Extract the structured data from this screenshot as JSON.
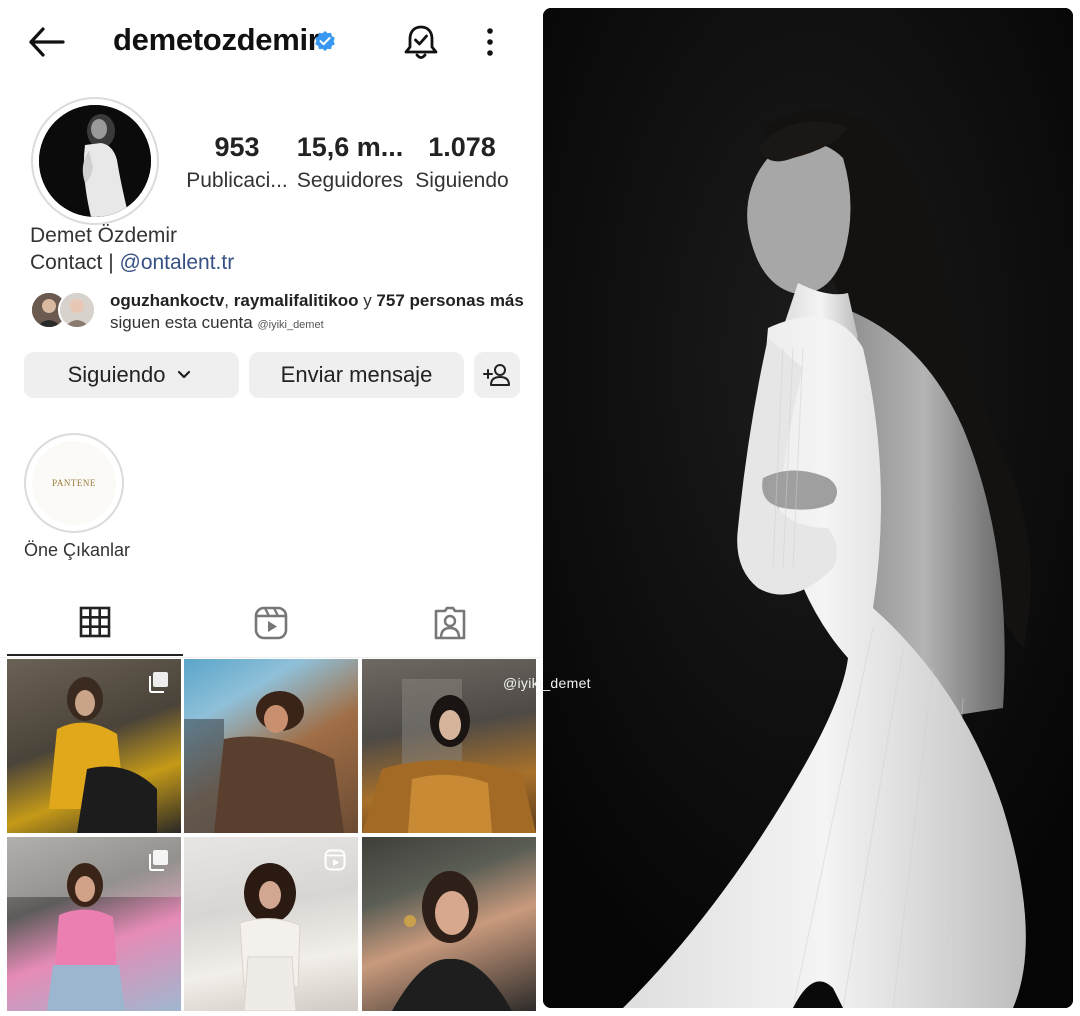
{
  "header": {
    "username": "demetozdemir"
  },
  "stats": {
    "posts_count": "953",
    "posts_label": "Publicaci...",
    "followers_count": "15,6 m...",
    "followers_label": "Seguidores",
    "following_count": "1.078",
    "following_label": "Siguiendo"
  },
  "profile": {
    "full_name": "Demet Özdemir",
    "bio_prefix": "Contact | ",
    "bio_link": "@ontalent.tr"
  },
  "mutual": {
    "user1": "oguzhankoctv",
    "separator": ", ",
    "user2": "raymalifalitikoo",
    "conjunction": " y ",
    "others": "757 personas más",
    "suffix": " siguen esta cuenta",
    "watermark": "@iyiki_demet"
  },
  "actions": {
    "following_label": "Siguiendo",
    "message_label": "Enviar mensaje"
  },
  "highlights": [
    {
      "label": "Öne Çıkanlar",
      "cover_text": "PANTENE"
    }
  ],
  "tabs": [
    {
      "name": "posts-grid",
      "icon": "grid-icon",
      "active": true
    },
    {
      "name": "reels",
      "icon": "reels-icon",
      "active": false
    },
    {
      "name": "tagged",
      "icon": "tagged-person-icon",
      "active": false
    }
  ],
  "grid_posts": [
    {
      "badge": "carousel-icon"
    },
    {
      "badge": ""
    },
    {
      "badge": ""
    },
    {
      "badge": "carousel-icon"
    },
    {
      "badge": "reel-icon"
    },
    {
      "badge": ""
    }
  ],
  "overlay_watermark": "@iyiki_demet",
  "colors": {
    "verified_blue": "#3897f0",
    "link_blue": "#385185",
    "button_gray": "#efefef",
    "photo_bg": "#0a0a0a"
  }
}
